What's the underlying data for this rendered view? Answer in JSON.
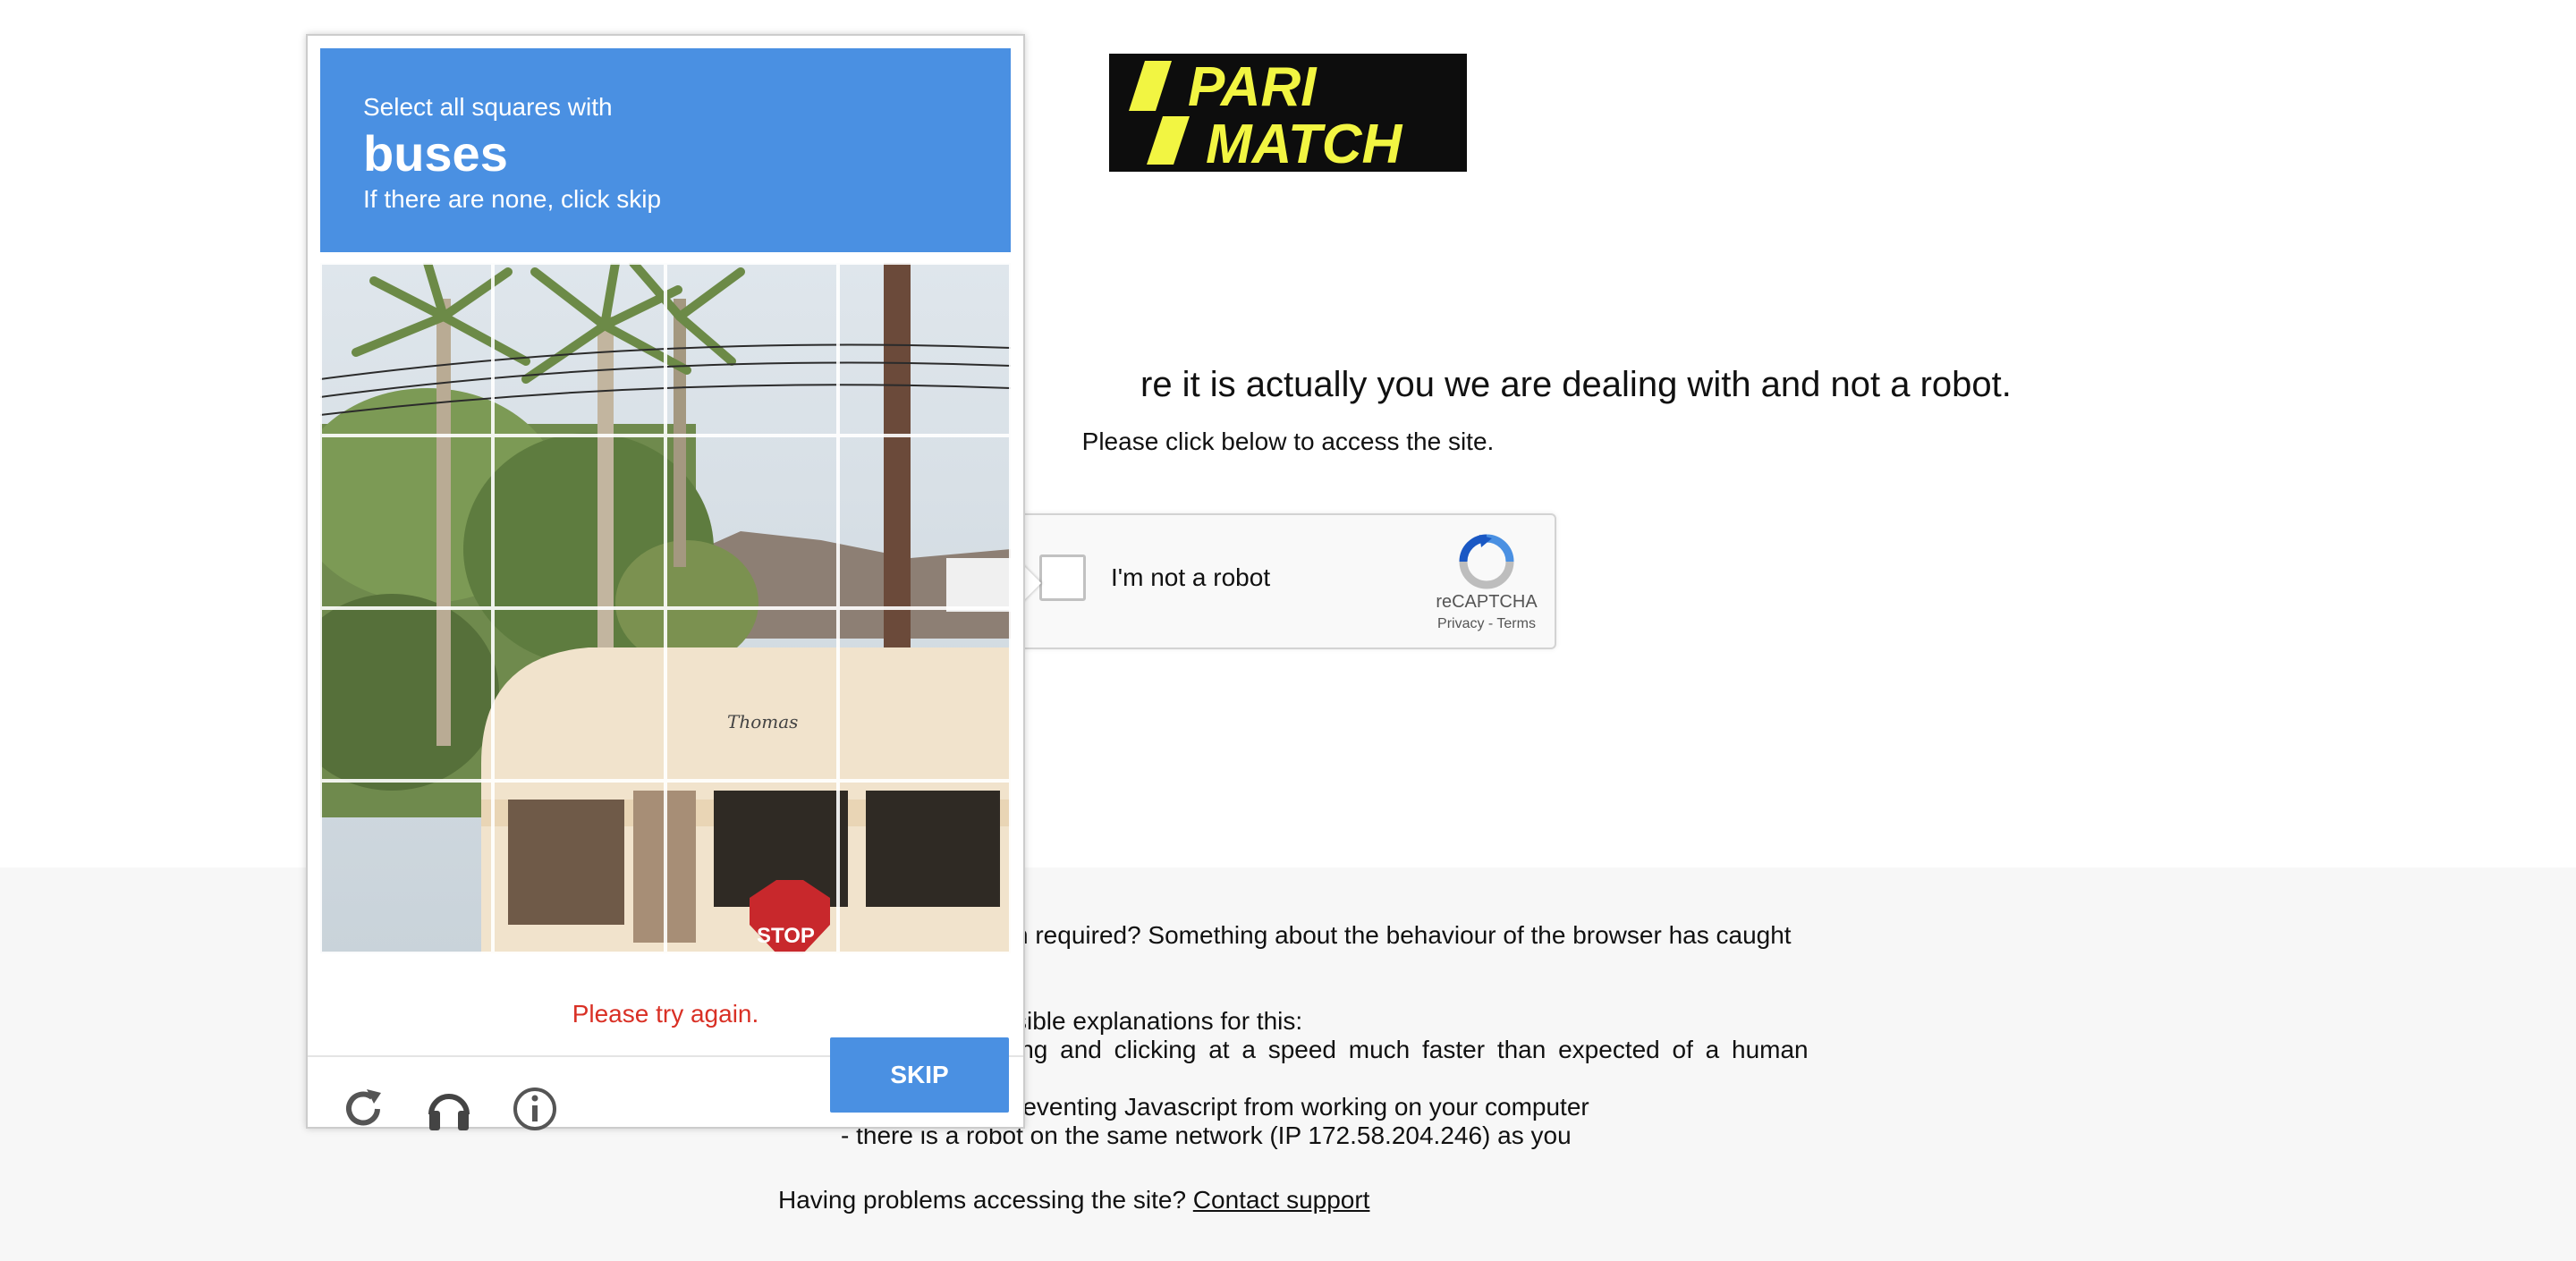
{
  "logo": {
    "line1": "PARI",
    "line2": "MATCH",
    "bg": "#0d0d0d",
    "fg": "#f2f542"
  },
  "page": {
    "headline_visible": "re it is actually you we are dealing with and not a robot.",
    "subline": "Please click below to access the site."
  },
  "recaptcha": {
    "checkbox_label": "I'm not a robot",
    "brand": "reCAPTCHA",
    "privacy": "Privacy",
    "separator": " - ",
    "terms": "Terms"
  },
  "footer": {
    "line1": "n required? Something about the behaviour of the browser has caught",
    "line2": "sible explanations for this:",
    "line3": "ing and clicking at a speed much faster than expected of a human",
    "line4": "reventing Javascript from working on your computer",
    "line5": "- there is a robot on the same network (IP 172.58.204.246) as you",
    "support_prefix": "Having problems accessing the site?",
    "support_link": "Contact support"
  },
  "challenge": {
    "instruction_small": "Select all squares with",
    "target_object": "buses",
    "instruction_tail": "If there are none, click skip",
    "error_message": "Please try again.",
    "skip_label": "SKIP",
    "bus_sign_text": "Thomas",
    "stop_sign_text": "STOP",
    "tools": [
      "reload-icon",
      "audio-headphones-icon",
      "info-icon"
    ],
    "accent_color": "#4a90e2",
    "error_color": "#d93025"
  }
}
